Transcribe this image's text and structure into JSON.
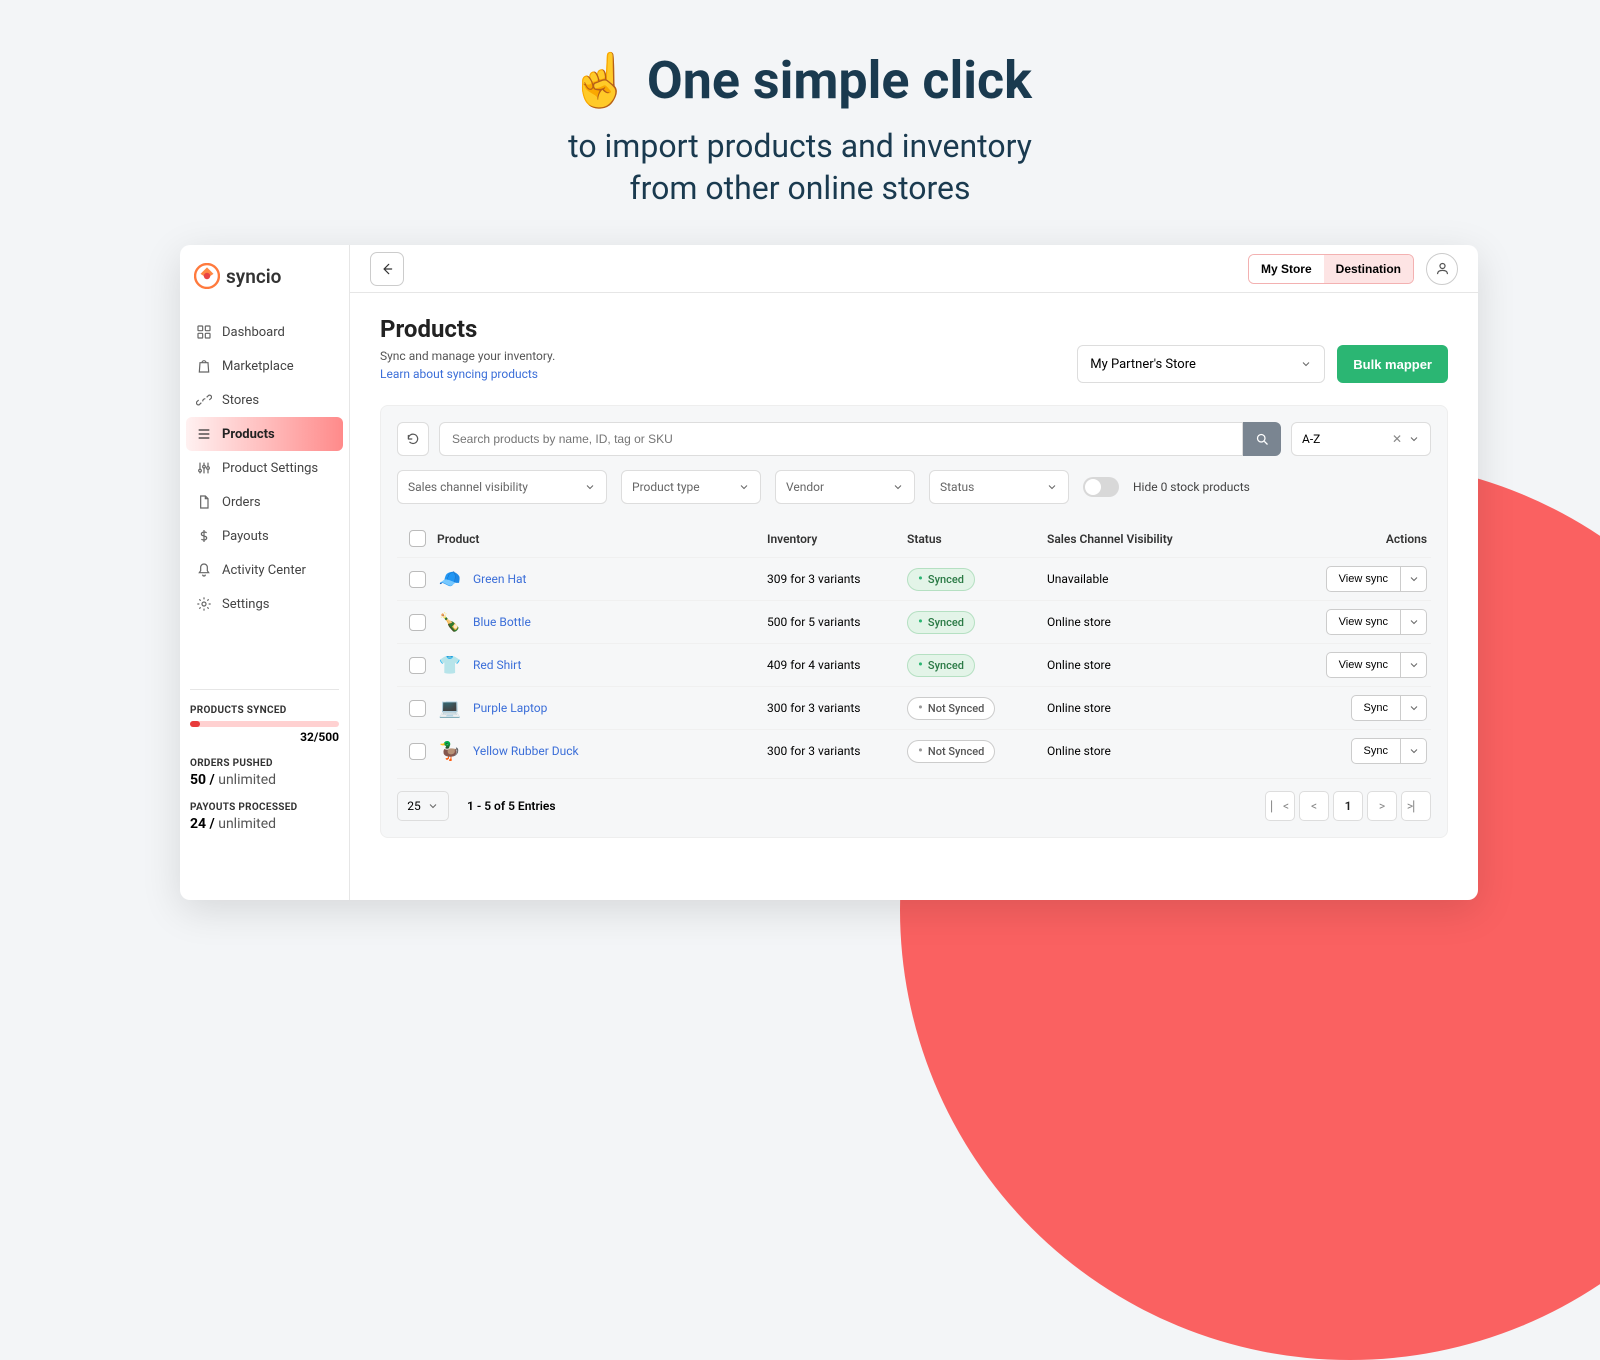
{
  "hero": {
    "emoji": "☝️",
    "title": "One simple click",
    "sub1": "to import products and inventory",
    "sub2": "from other online stores"
  },
  "brand": "syncio",
  "nav": [
    {
      "label": "Dashboard",
      "icon": "grid"
    },
    {
      "label": "Marketplace",
      "icon": "bag"
    },
    {
      "label": "Stores",
      "icon": "link"
    },
    {
      "label": "Products",
      "icon": "list",
      "active": true
    },
    {
      "label": "Product Settings",
      "icon": "settings2"
    },
    {
      "label": "Orders",
      "icon": "file"
    },
    {
      "label": "Payouts",
      "icon": "dollar"
    },
    {
      "label": "Activity Center",
      "icon": "bell"
    },
    {
      "label": "Settings",
      "icon": "gear"
    }
  ],
  "stats": {
    "synced_label": "PRODUCTS SYNCED",
    "synced_value": "32/500",
    "orders_label": "ORDERS PUSHED",
    "orders_value": "50 /",
    "orders_suffix": "unlimited",
    "payouts_label": "PAYOUTS PROCESSED",
    "payouts_value": "24 /",
    "payouts_suffix": "unlimited"
  },
  "topbar": {
    "my_store": "My Store",
    "destination": "Destination"
  },
  "page": {
    "title": "Products",
    "sub": "Sync and manage your inventory.",
    "link": "Learn about syncing products",
    "store_label": "My Partner's Store",
    "bulk_label": "Bulk mapper"
  },
  "filters": {
    "search_placeholder": "Search products by name, ID, tag or SKU",
    "sort": "A-Z",
    "visibility": "Sales channel visibility",
    "product_type": "Product type",
    "vendor": "Vendor",
    "status": "Status",
    "hide_zero": "Hide 0 stock products"
  },
  "table": {
    "headers": {
      "product": "Product",
      "inventory": "Inventory",
      "status": "Status",
      "visibility": "Sales Channel Visibility",
      "actions": "Actions"
    },
    "rows": [
      {
        "name": "Green Hat",
        "emoji": "🧢",
        "inventory": "309 for 3 variants",
        "status": "Synced",
        "synced": true,
        "visibility": "Unavailable",
        "action": "View sync"
      },
      {
        "name": "Blue Bottle",
        "emoji": "🍾",
        "inventory": "500 for 5 variants",
        "status": "Synced",
        "synced": true,
        "visibility": "Online store",
        "action": "View sync"
      },
      {
        "name": "Red Shirt",
        "emoji": "👕",
        "inventory": "409 for 4 variants",
        "status": "Synced",
        "synced": true,
        "visibility": "Online store",
        "action": "View sync"
      },
      {
        "name": "Purple Laptop",
        "emoji": "💻",
        "inventory": "300 for 3 variants",
        "status": "Not Synced",
        "synced": false,
        "visibility": "Online store",
        "action": "Sync"
      },
      {
        "name": "Yellow Rubber Duck",
        "emoji": "🦆",
        "inventory": "300 for 3 variants",
        "status": "Not Synced",
        "synced": false,
        "visibility": "Online store",
        "action": "Sync"
      }
    ],
    "per_page": "25",
    "entries": "1 - 5 of 5 Entries",
    "current_page": "1"
  }
}
